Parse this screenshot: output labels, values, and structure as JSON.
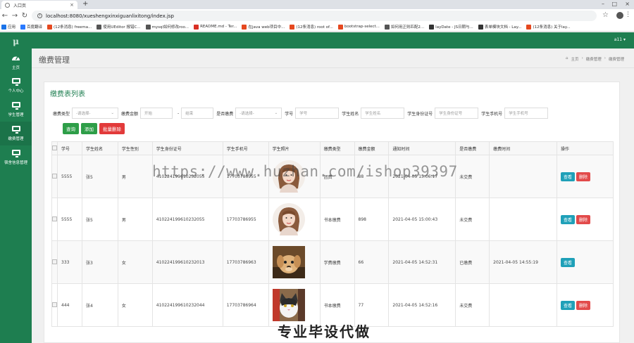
{
  "browser": {
    "tab_title": "入口页",
    "url": "localhost:8080/xueshengxinxiguanlixitong/index.jsp",
    "bookmarks": [
      {
        "label": "应用",
        "icon": "apps-icon",
        "color": "#1a73e8"
      },
      {
        "label": "百度翻译",
        "icon": "translate-icon",
        "color": "#2979ff"
      },
      {
        "label": "(12条消息) freema...",
        "icon": "csdn-icon",
        "color": "#e5481f"
      },
      {
        "label": "使用UEditor 报错C...",
        "icon": "cnblogs-icon",
        "color": "#555555"
      },
      {
        "label": "mysql如何修改roo...",
        "icon": "cnblogs-icon",
        "color": "#555555"
      },
      {
        "label": "README.md - Ter...",
        "icon": "github-icon",
        "color": "#d93025"
      },
      {
        "label": "在java web项目中...",
        "icon": "csdn-icon",
        "color": "#e5481f"
      },
      {
        "label": "(12条消息) root of...",
        "icon": "csdn-icon",
        "color": "#e5481f"
      },
      {
        "label": "bootstrap-select...",
        "icon": "bootstrap-icon",
        "color": "#e5481f"
      },
      {
        "label": "如何用正则匹配2...",
        "icon": "cnblogs-icon",
        "color": "#555555"
      },
      {
        "label": "layDate - JS日期与...",
        "icon": "layui-icon",
        "color": "#333333"
      },
      {
        "label": "表单模块文档 - Lay...",
        "icon": "layui-icon",
        "color": "#333333"
      },
      {
        "label": "(12条消息) 关于lay...",
        "icon": "csdn-icon",
        "color": "#e5481f"
      }
    ]
  },
  "sidebar": {
    "logo": "μ",
    "items": [
      {
        "label": "主页",
        "icon": "dashboard-icon"
      },
      {
        "label": "个人中心",
        "icon": "monitor-icon"
      },
      {
        "label": "学生管理",
        "icon": "monitor-icon"
      },
      {
        "label": "缴费管理",
        "icon": "monitor-icon"
      },
      {
        "label": "宿舍信息管理",
        "icon": "monitor-icon"
      }
    ]
  },
  "topnav": {
    "user": "a11 ▾"
  },
  "header": {
    "title": "缴费管理",
    "breadcrumb": [
      "主页",
      "缴费管理",
      "缴费管理"
    ]
  },
  "panel": {
    "title": "缴费表列表"
  },
  "filters": {
    "type_label": "缴费类型",
    "type_value": "-请选择-",
    "amount_label": "缴费金额",
    "amount_start": "开始",
    "amount_sep": "-",
    "amount_end": "结束",
    "paid_label": "是否缴费",
    "paid_value": "-请选择-",
    "id_label": "学号",
    "id_placeholder": "学号",
    "name_label": "学生姓名",
    "name_placeholder": "学生姓名",
    "idcard_label": "学生身份证号",
    "idcard_placeholder": "学生身份证号",
    "phone_label": "学生手机号",
    "phone_placeholder": "学生手机号"
  },
  "actions": {
    "search": "查询",
    "add": "添加",
    "batch_delete": "批量删除"
  },
  "table": {
    "headers": [
      "学号",
      "学生姓名",
      "学生性别",
      "学生身份证号",
      "学生手机号",
      "学生照片",
      "缴费类型",
      "缴费金额",
      "通知时间",
      "是否缴费",
      "缴费时间",
      "操作"
    ],
    "view_label": "查看",
    "delete_label": "删除",
    "rows": [
      {
        "id": "5555",
        "name": "张5",
        "gender": "男",
        "idcard": "410224199610232055",
        "phone": "17703786955",
        "photo": "girl",
        "type": "团费",
        "amount": "88",
        "notice": "2021-04-05 15:06:17",
        "paid": "未交费",
        "paid_time": "",
        "can_delete": true
      },
      {
        "id": "5555",
        "name": "张5",
        "gender": "男",
        "idcard": "410224199610232055",
        "phone": "17703786955",
        "photo": "girl",
        "type": "书本缴费",
        "amount": "898",
        "notice": "2021-04-05 15:00:43",
        "paid": "未交费",
        "paid_time": "",
        "can_delete": true
      },
      {
        "id": "333",
        "name": "张3",
        "gender": "女",
        "idcard": "410224199610232013",
        "phone": "17703786963",
        "photo": "puppy",
        "type": "学费缴费",
        "amount": "66",
        "notice": "2021-04-05 14:52:31",
        "paid": "已缴费",
        "paid_time": "2021-04-05 14:55:19",
        "can_delete": false
      },
      {
        "id": "444",
        "name": "张4",
        "gender": "女",
        "idcard": "410224199610232044",
        "phone": "17703786964",
        "photo": "cat",
        "type": "书本缴费",
        "amount": "77",
        "notice": "2021-04-05 14:52:16",
        "paid": "未交费",
        "paid_time": "",
        "can_delete": true
      }
    ]
  },
  "overlay": {
    "watermark": "https://www.huzhan.com/ishop39397",
    "banner": "专业毕设代做"
  }
}
